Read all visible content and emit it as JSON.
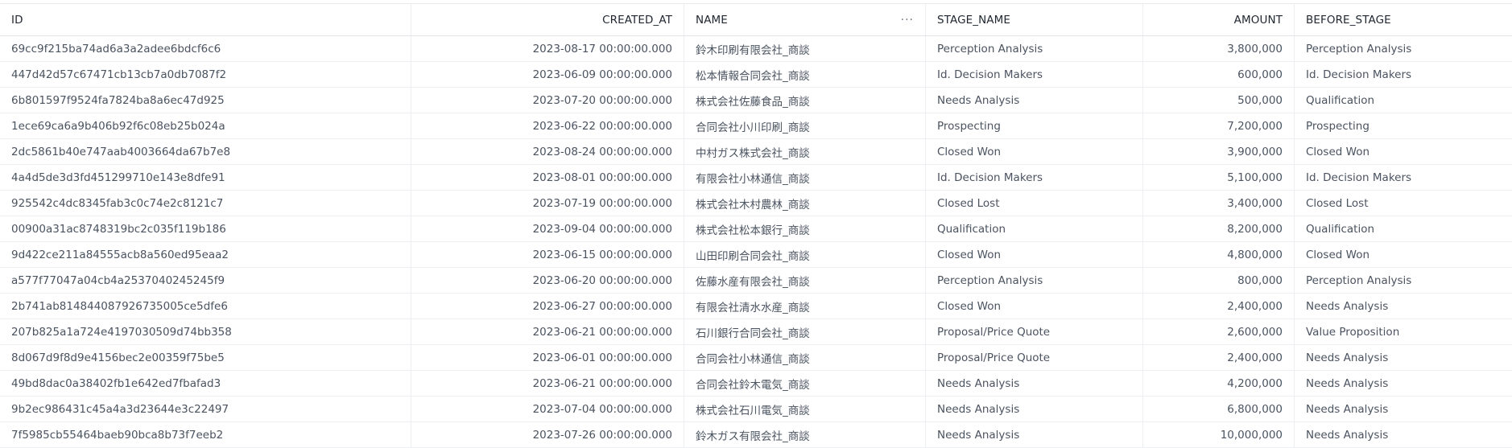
{
  "columns": [
    "ID",
    "CREATED_AT",
    "NAME",
    "STAGE_NAME",
    "AMOUNT",
    "BEFORE_STAGE"
  ],
  "name_menu_icon": "more-horizontal-icon",
  "rows": [
    [
      "69cc9f215ba74ad6a3a2adee6bdcf6c6",
      "2023-08-17 00:00:00.000",
      "鈴木印刷有限会社_商談",
      "Perception Analysis",
      "3,800,000",
      "Perception Analysis"
    ],
    [
      "447d42d57c67471cb13cb7a0db7087f2",
      "2023-06-09 00:00:00.000",
      "松本情報合同会社_商談",
      "Id. Decision Makers",
      "600,000",
      "Id. Decision Makers"
    ],
    [
      "6b801597f9524fa7824ba8a6ec47d925",
      "2023-07-20 00:00:00.000",
      "株式会社佐藤食品_商談",
      "Needs Analysis",
      "500,000",
      "Qualification"
    ],
    [
      "1ece69ca6a9b406b92f6c08eb25b024a",
      "2023-06-22 00:00:00.000",
      "合同会社小川印刷_商談",
      "Prospecting",
      "7,200,000",
      "Prospecting"
    ],
    [
      "2dc5861b40e747aab4003664da67b7e8",
      "2023-08-24 00:00:00.000",
      "中村ガス株式会社_商談",
      "Closed Won",
      "3,900,000",
      "Closed Won"
    ],
    [
      "4a4d5de3d3fd451299710e143e8dfe91",
      "2023-08-01 00:00:00.000",
      "有限会社小林通信_商談",
      "Id. Decision Makers",
      "5,100,000",
      "Id. Decision Makers"
    ],
    [
      "925542c4dc8345fab3c0c74e2c8121c7",
      "2023-07-19 00:00:00.000",
      "株式会社木村農林_商談",
      " Closed Lost",
      "3,400,000",
      " Closed Lost"
    ],
    [
      "00900a31ac8748319bc2c035f119b186",
      "2023-09-04 00:00:00.000",
      "株式会社松本銀行_商談",
      "Qualification",
      "8,200,000",
      "Qualification"
    ],
    [
      "9d422ce211a84555acb8a560ed95eaa2",
      "2023-06-15 00:00:00.000",
      "山田印刷合同会社_商談",
      "Closed Won",
      "4,800,000",
      "Closed Won"
    ],
    [
      "a577f77047a04cb4a2537040245245f9",
      "2023-06-20 00:00:00.000",
      "佐藤水産有限会社_商談",
      "Perception Analysis",
      "800,000",
      "Perception Analysis"
    ],
    [
      "2b741ab814844087926735005ce5dfe6",
      "2023-06-27 00:00:00.000",
      "有限会社清水水産_商談",
      "Closed Won",
      "2,400,000",
      "Needs Analysis"
    ],
    [
      "207b825a1a724e4197030509d74bb358",
      "2023-06-21 00:00:00.000",
      "石川銀行合同会社_商談",
      "Proposal/Price Quote",
      "2,600,000",
      "Value Proposition"
    ],
    [
      "8d067d9f8d9e4156bec2e00359f75be5",
      "2023-06-01 00:00:00.000",
      "合同会社小林通信_商談",
      "Proposal/Price Quote",
      "2,400,000",
      "Needs Analysis"
    ],
    [
      "49bd8dac0a38402fb1e642ed7fbafad3",
      "2023-06-21 00:00:00.000",
      "合同会社鈴木電気_商談",
      "Needs Analysis",
      "4,200,000",
      "Needs Analysis"
    ],
    [
      "9b2ec986431c45a4a3d23644e3c22497",
      "2023-07-04 00:00:00.000",
      "株式会社石川電気_商談",
      "Needs Analysis",
      "6,800,000",
      "Needs Analysis"
    ],
    [
      "7f5985cb55464baeb90bca8b73f7eeb2",
      "2023-07-26 00:00:00.000",
      "鈴木ガス有限会社_商談",
      "Needs Analysis",
      "10,000,000",
      "Needs Analysis"
    ]
  ]
}
